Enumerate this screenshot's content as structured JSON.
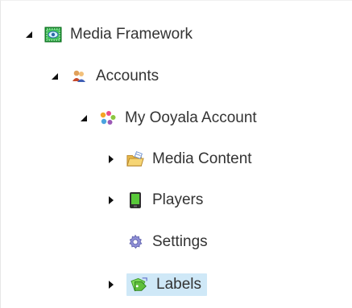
{
  "tree": {
    "nodes": [
      {
        "label": "Media Framework",
        "icon": "media-framework-icon",
        "expanded": true,
        "has_toggle": true,
        "depth": 0,
        "selected": false
      },
      {
        "label": "Accounts",
        "icon": "accounts-icon",
        "expanded": true,
        "has_toggle": true,
        "depth": 1,
        "selected": false
      },
      {
        "label": "My Ooyala Account",
        "icon": "ooyala-account-icon",
        "expanded": true,
        "has_toggle": true,
        "depth": 2,
        "selected": false
      },
      {
        "label": "Media Content",
        "icon": "folder-icon",
        "expanded": false,
        "has_toggle": true,
        "depth": 3,
        "selected": false
      },
      {
        "label": "Players",
        "icon": "player-icon",
        "expanded": false,
        "has_toggle": true,
        "depth": 3,
        "selected": false
      },
      {
        "label": "Settings",
        "icon": "settings-gear-icon",
        "expanded": false,
        "has_toggle": false,
        "depth": 3,
        "selected": false
      },
      {
        "label": "Labels",
        "icon": "labels-icon",
        "expanded": false,
        "has_toggle": true,
        "depth": 3,
        "selected": true
      }
    ]
  },
  "colors": {
    "selection_bg": "#cfe8f7",
    "text": "#333333",
    "toggle": "#111111"
  }
}
